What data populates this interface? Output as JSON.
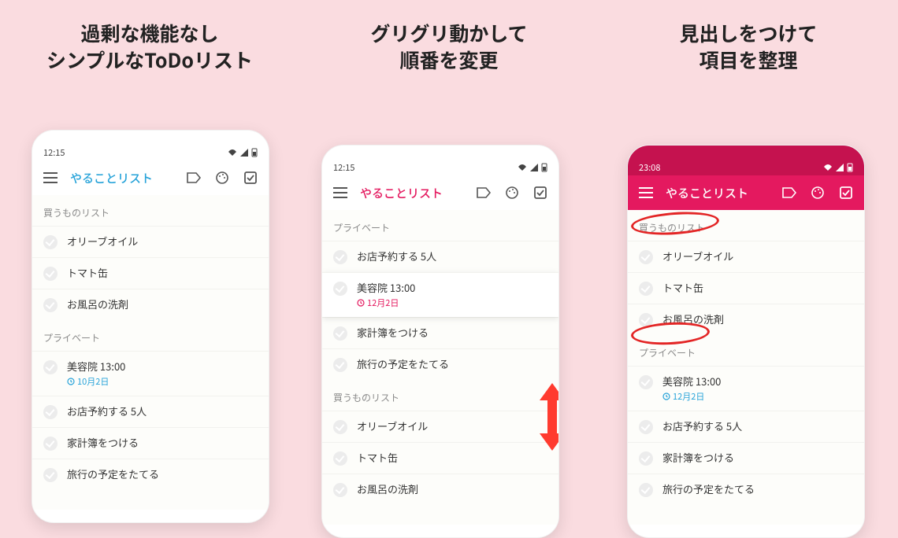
{
  "captions": {
    "c1": "過剰な機能なし\nシンプルなToDoリスト",
    "c2": "グリグリ動かして\n順番を変更",
    "c3": "見出しをつけて\n項目を整理"
  },
  "phone1": {
    "clock": "12:15",
    "title": "やることリスト",
    "sections": [
      {
        "header": "買うものリスト",
        "items": [
          {
            "text": "オリーブオイル"
          },
          {
            "text": "トマト缶"
          },
          {
            "text": "お風呂の洗剤"
          }
        ]
      },
      {
        "header": "プライベート",
        "items": [
          {
            "text": "美容院 13:00",
            "sub": "10月2日",
            "sub_color": "blue"
          },
          {
            "text": "お店予約する 5人"
          },
          {
            "text": "家計簿をつける"
          },
          {
            "text": "旅行の予定をたてる"
          }
        ]
      }
    ]
  },
  "phone2": {
    "clock": "12:15",
    "title": "やることリスト",
    "sections": [
      {
        "header": "プライベート",
        "items": [
          {
            "text": "お店予約する 5人"
          },
          {
            "text": "美容院 13:00",
            "sub": "12月2日",
            "sub_color": "red",
            "highlight": true
          },
          {
            "text": "家計簿をつける"
          },
          {
            "text": "旅行の予定をたてる"
          }
        ]
      },
      {
        "header": "買うものリスト",
        "items": [
          {
            "text": "オリーブオイル"
          },
          {
            "text": "トマト缶"
          },
          {
            "text": "お風呂の洗剤"
          }
        ]
      }
    ]
  },
  "phone3": {
    "clock": "23:08",
    "title": "やることリスト",
    "sections": [
      {
        "header": "買うものリスト",
        "items": [
          {
            "text": "オリーブオイル"
          },
          {
            "text": "トマト缶"
          },
          {
            "text": "お風呂の洗剤"
          }
        ]
      },
      {
        "header": "プライベート",
        "items": [
          {
            "text": "美容院 13:00",
            "sub": "12月2日",
            "sub_color": "blue"
          },
          {
            "text": "お店予約する 5人"
          },
          {
            "text": "家計簿をつける"
          },
          {
            "text": "旅行の予定をたてる"
          }
        ]
      }
    ]
  }
}
